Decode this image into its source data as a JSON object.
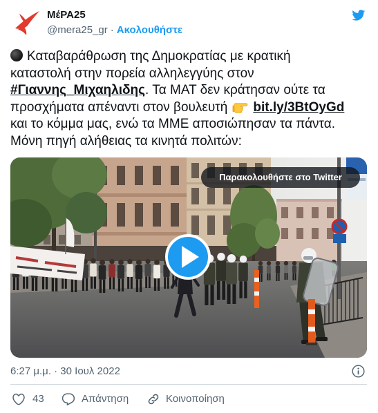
{
  "account": {
    "name": "ΜέΡΑ25",
    "handle": "@mera25_gr",
    "separator": "·",
    "follow_label": "Ακολουθήστε",
    "avatar_icon": "mera25-logo",
    "platform_icon": "twitter-bird-icon"
  },
  "tweet": {
    "segments": [
      "Καταβαράθρωση της Δημοκρατίας με κρατική",
      "καταστολή στην πορεία αλληλεγγύης στον",
      "#Γιαννης_Μιχαηλιδης",
      ". Τα ΜΑΤ δεν κράτησαν ούτε τα",
      "προσχήματα απέναντι στον βουλευτή",
      "bit.ly/3BtOyGd",
      "και το κόμμα μας, ενώ τα ΜΜΕ αποσιώπησαν τα πάντα.",
      "Μόνη πηγή αλήθειας τα κινητά πολιτών:"
    ],
    "emojis": [
      "black-circle-emoji",
      "backhand-index-pointing-right-emoji"
    ]
  },
  "media": {
    "type": "video",
    "watch_label": "Παρακολουθήστε στο Twitter",
    "play_icon": "play-icon"
  },
  "meta": {
    "timestamp": "6:27 μ.μ. · 30 Ιουλ 2022",
    "info_icon": "info-icon"
  },
  "actions": {
    "like_count": "43",
    "like_icon": "heart-icon",
    "reply_label": "Απάντηση",
    "reply_icon": "reply-bubble-icon",
    "share_label": "Κοινοποίηση",
    "share_icon": "link-icon"
  },
  "colors": {
    "accent": "#1d9bf0",
    "text": "#0f1419",
    "secondary": "#536471",
    "divider": "#cfd9de",
    "brand_red": "#e23a2e"
  }
}
